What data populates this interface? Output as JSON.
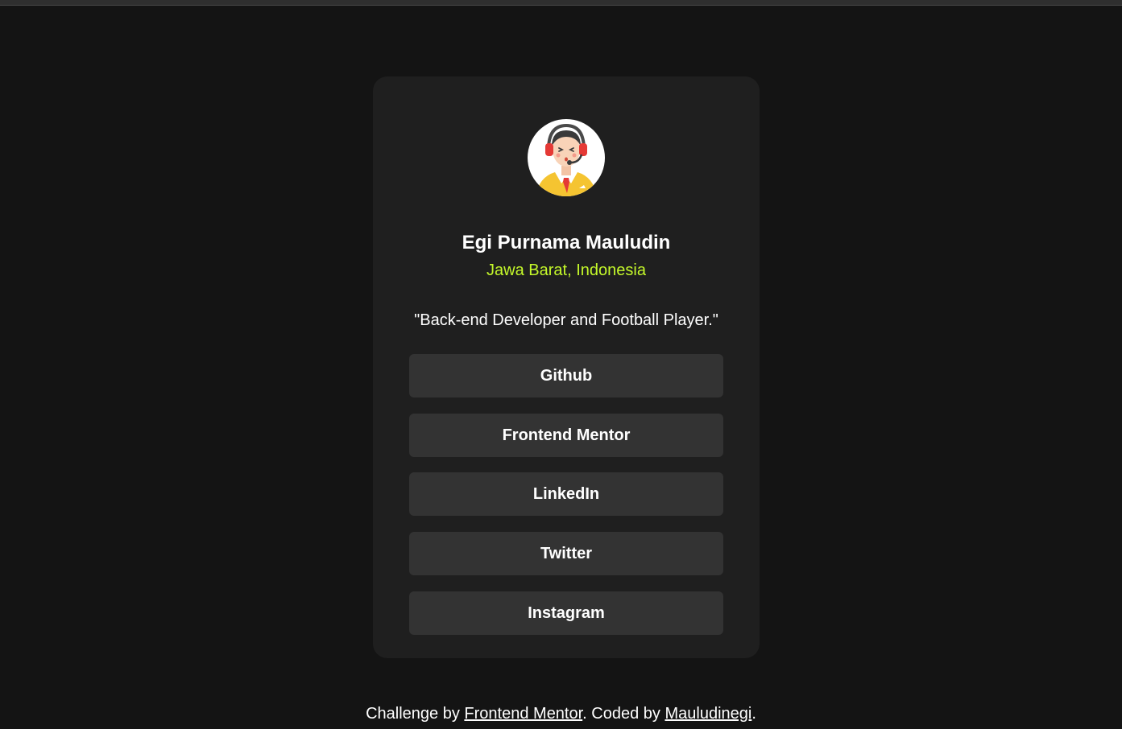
{
  "profile": {
    "name": "Egi Purnama Mauludin",
    "location": "Jawa Barat, Indonesia",
    "bio": "\"Back-end Developer and Football Player.\"",
    "avatar_icon": "support-agent-avatar-icon"
  },
  "links": [
    {
      "label": "Github"
    },
    {
      "label": "Frontend Mentor"
    },
    {
      "label": "LinkedIn"
    },
    {
      "label": "Twitter"
    },
    {
      "label": "Instagram"
    }
  ],
  "footer": {
    "prefix": "Challenge by ",
    "challenge_link": "Frontend Mentor",
    "middle": ". Coded by ",
    "author_link": "Mauludinegi",
    "suffix": "."
  },
  "colors": {
    "background": "#141414",
    "card": "#1f1f1f",
    "button": "#333333",
    "accent": "#c4f82a",
    "text": "#ffffff"
  }
}
